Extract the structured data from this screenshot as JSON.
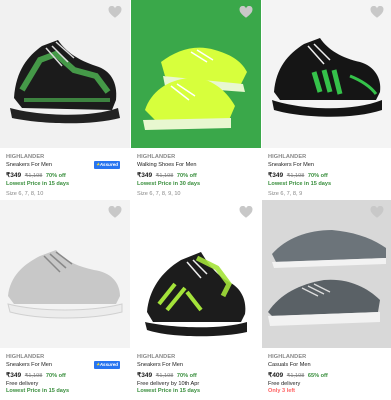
{
  "products": [
    {
      "brand": "HIGHLANDER",
      "title": "Sneakers For Men",
      "price": "₹349",
      "mrp": "₹1,198",
      "off": "70% off",
      "note1": "Lowest Price in 15 days",
      "note2": "",
      "note3": "",
      "size": "Size 6, 7, 8, 10",
      "assured": "Assured",
      "bg": "#f1f1f1",
      "shoe": "#1b1b1b",
      "accent": "#4caf50",
      "sole": "#222222",
      "icon": "heart-outline-icon"
    },
    {
      "brand": "HIGHLANDER",
      "title": "Walking Shoes For Men",
      "price": "₹349",
      "mrp": "₹1,198",
      "off": "70% off",
      "note1": "Lowest Price in 30 days",
      "note2": "",
      "note3": "",
      "size": "Size 6, 7, 8, 9, 10",
      "assured": "",
      "bg": "#3aa84a",
      "shoe": "#d7ff3c",
      "accent": "#b9e82a",
      "sole": "#e8f7d0",
      "icon": "heart-outline-icon"
    },
    {
      "brand": "HIGHLANDER",
      "title": "Sneakers For Men",
      "price": "₹349",
      "mrp": "₹1,198",
      "off": "70% off",
      "note1": "Lowest Price in 15 days",
      "note2": "",
      "note3": "",
      "size": "Size 6, 7, 8, 9",
      "assured": "",
      "bg": "#f4f4f4",
      "shoe": "#151515",
      "accent": "#35c24a",
      "sole": "#151515",
      "icon": "heart-outline-icon"
    },
    {
      "brand": "HIGHLANDER",
      "title": "Sneakers For Men",
      "price": "₹349",
      "mrp": "₹1,198",
      "off": "70% off",
      "note1": "",
      "note2": "Free delivery",
      "note3": "Lowest Price in 15 days",
      "size": "",
      "assured": "Assured",
      "bg": "#f3f3f3",
      "shoe": "#c8c8c8",
      "accent": "#d6d6d6",
      "sole": "#ececec",
      "icon": "heart-outline-icon"
    },
    {
      "brand": "HIGHLANDER",
      "title": "Sneakers For Men",
      "price": "₹349",
      "mrp": "₹1,198",
      "off": "70% off",
      "note1": "",
      "note2": "Free delivery by 10th Apr",
      "note3": "Lowest Price in 15 days",
      "size": "",
      "assured": "",
      "bg": "#ffffff",
      "shoe": "#1c1c1c",
      "accent": "#a4e33a",
      "sole": "#1c1c1c",
      "icon": "heart-outline-icon"
    },
    {
      "brand": "HIGHLANDER",
      "title": "Casuals For Men",
      "price": "₹409",
      "mrp": "₹1,198",
      "off": "65% off",
      "note1": "",
      "note2": "Free delivery",
      "note3": "Only 3 left",
      "size": "",
      "assured": "",
      "bg": "#d8d8d8",
      "shoe": "#6c747a",
      "accent": "#5a6166",
      "sole": "#f2f2f2",
      "icon": "heart-outline-icon"
    }
  ]
}
